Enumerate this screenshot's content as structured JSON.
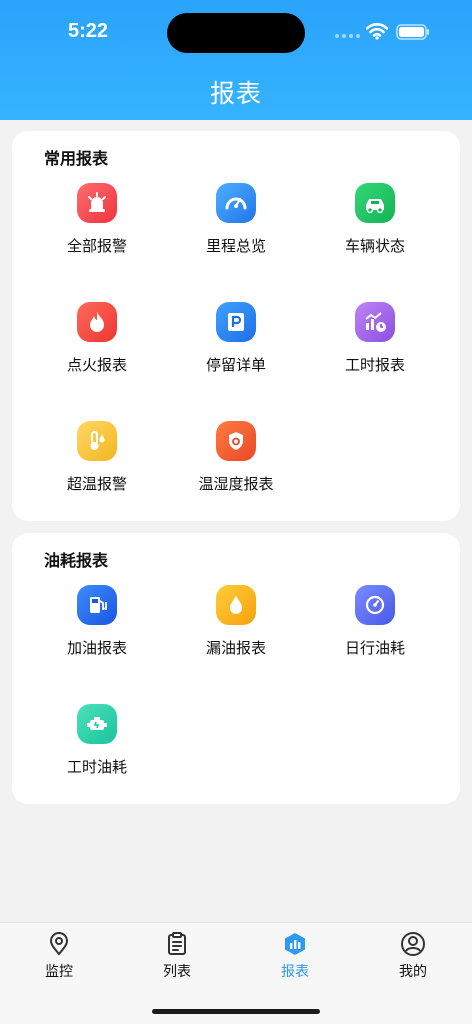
{
  "status_bar": {
    "time": "5:22"
  },
  "header": {
    "title": "报表"
  },
  "sections": [
    {
      "title": "常用报表",
      "items": [
        {
          "label": "全部报警",
          "icon": "alarm-light-icon",
          "color": "#f4454e"
        },
        {
          "label": "里程总览",
          "icon": "speedometer-icon",
          "color": "#2f8df0"
        },
        {
          "label": "车辆状态",
          "icon": "car-icon",
          "color": "#1fc15f"
        },
        {
          "label": "点火报表",
          "icon": "flame-icon",
          "color": "#f4454e"
        },
        {
          "label": "停留详单",
          "icon": "parking-icon",
          "color": "#2f8df0"
        },
        {
          "label": "工时报表",
          "icon": "chart-clock-icon",
          "color": "#9a5de6"
        },
        {
          "label": "超温报警",
          "icon": "thermometer-icon",
          "color": "#f9c233"
        },
        {
          "label": "温湿度报表",
          "icon": "shield-temperature-icon",
          "color": "#f0642c"
        }
      ]
    },
    {
      "title": "油耗报表",
      "items": [
        {
          "label": "加油报表",
          "icon": "fuel-pump-icon",
          "color": "#2a6df2"
        },
        {
          "label": "漏油报表",
          "icon": "oil-drop-icon",
          "color": "#f9b21d"
        },
        {
          "label": "日行油耗",
          "icon": "gauge-icon",
          "color": "#5b6ff0"
        },
        {
          "label": "工时油耗",
          "icon": "engine-icon",
          "color": "#2dd1a8"
        }
      ]
    }
  ],
  "tabbar": {
    "active": "报表",
    "tabs": [
      {
        "label": "监控",
        "icon": "location-pin-icon"
      },
      {
        "label": "列表",
        "icon": "clipboard-icon"
      },
      {
        "label": "报表",
        "icon": "report-hexagon-icon"
      },
      {
        "label": "我的",
        "icon": "user-circle-icon"
      }
    ]
  }
}
